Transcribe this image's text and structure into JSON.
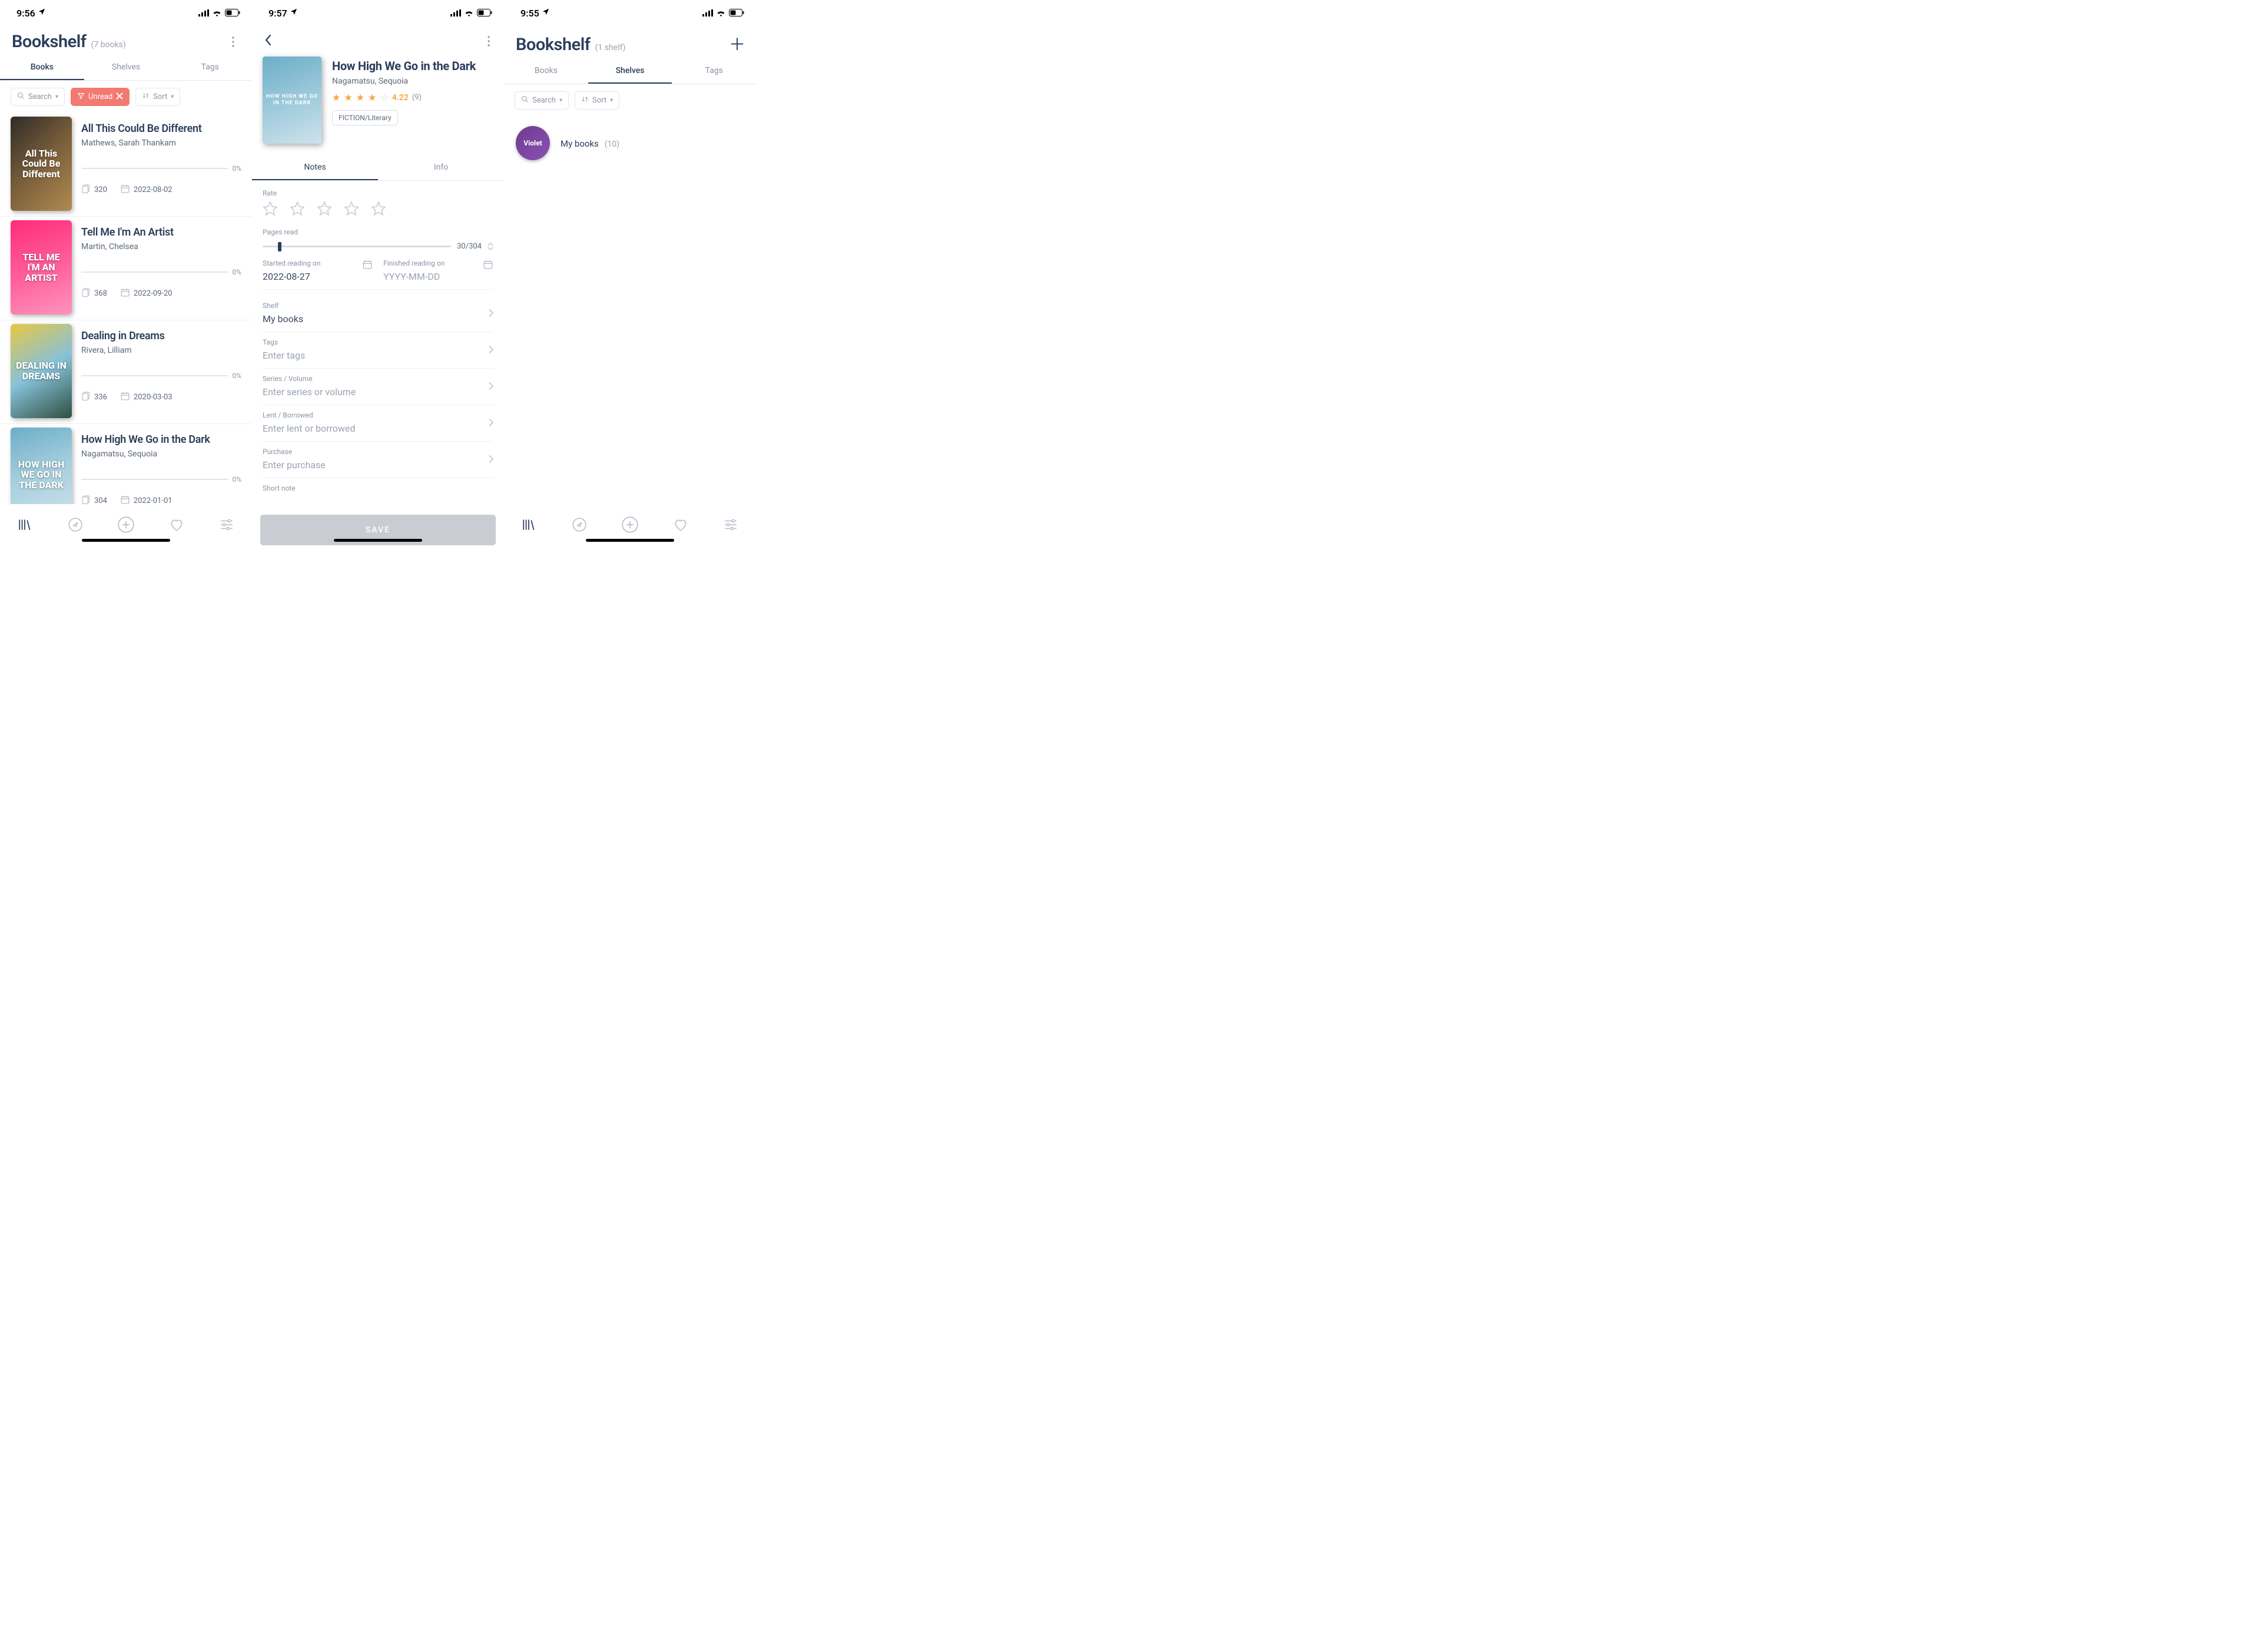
{
  "screen1": {
    "status_time": "9:56",
    "title": "Bookshelf",
    "subtitle": "(7 books)",
    "tabs": {
      "books": "Books",
      "shelves": "Shelves",
      "tags": "Tags"
    },
    "search_placeholder": "Search",
    "filter_label": "Unread",
    "sort_label": "Sort",
    "books": [
      {
        "title": "All This Could Be Different",
        "author": "Mathews, Sarah Thankam",
        "progress": "0%",
        "pages": "320",
        "date": "2022-08-02",
        "cover_text": "All This Could Be Different",
        "cover_style": "background:linear-gradient(135deg,#2e2b27,#7a5f3b,#b08b4f);"
      },
      {
        "title": "Tell Me I'm An Artist",
        "author": "Martin, Chelsea",
        "progress": "0%",
        "pages": "368",
        "date": "2022-09-20",
        "cover_text": "TELL ME I'M AN ARTIST",
        "cover_style": "background:linear-gradient(160deg,#ff2b7a,#ff5c9a,#ff93bd);"
      },
      {
        "title": "Dealing in Dreams",
        "author": "Rivera, Lilliam",
        "progress": "0%",
        "pages": "336",
        "date": "2020-03-03",
        "cover_text": "DEALING IN DREAMS",
        "cover_style": "background:linear-gradient(150deg,#e7c843,#86c1d9,#2f4e3f);"
      },
      {
        "title": "How High We Go in the Dark",
        "author": "Nagamatsu, Sequoia",
        "progress": "0%",
        "pages": "304",
        "date": "2022-01-01",
        "cover_text": "HOW HIGH WE GO IN THE DARK",
        "cover_style": "background:linear-gradient(160deg,#6BAEC8,#A8D0DE,#CDE3EC);"
      }
    ]
  },
  "screen2": {
    "status_time": "9:57",
    "title": "How High We Go in the Dark",
    "author": "Nagamatsu, Sequoia",
    "rating_num": "4.22",
    "rating_count": "(9)",
    "genre": "FICTION/Literary",
    "cover_text": "HOW HIGH WE GO IN THE DARK",
    "tabs": {
      "notes": "Notes",
      "info": "Info"
    },
    "labels": {
      "rate": "Rate",
      "pages_read": "Pages read",
      "started": "Started reading on",
      "finished": "Finished reading on",
      "shelf": "Shelf",
      "tags": "Tags",
      "series": "Series / Volume",
      "lent": "Lent / Borrowed",
      "purchase": "Purchase",
      "note": "Short note"
    },
    "values": {
      "pages_read": "30/304",
      "pages_read_num": 30,
      "pages_total_num": 304,
      "started": "2022-08-27",
      "finished_placeholder": "YYYY-MM-DD",
      "shelf": "My books",
      "tags_placeholder": "Enter tags",
      "series_placeholder": "Enter series or volume",
      "lent_placeholder": "Enter lent or borrowed",
      "purchase_placeholder": "Enter purchase"
    },
    "save": "SAVE"
  },
  "screen3": {
    "status_time": "9:55",
    "title": "Bookshelf",
    "subtitle": "(1 shelf)",
    "tabs": {
      "books": "Books",
      "shelves": "Shelves",
      "tags": "Tags"
    },
    "search_placeholder": "Search",
    "sort_label": "Sort",
    "shelf": {
      "name": "My books",
      "count": "(10)",
      "thumb_text": "Violet"
    }
  }
}
